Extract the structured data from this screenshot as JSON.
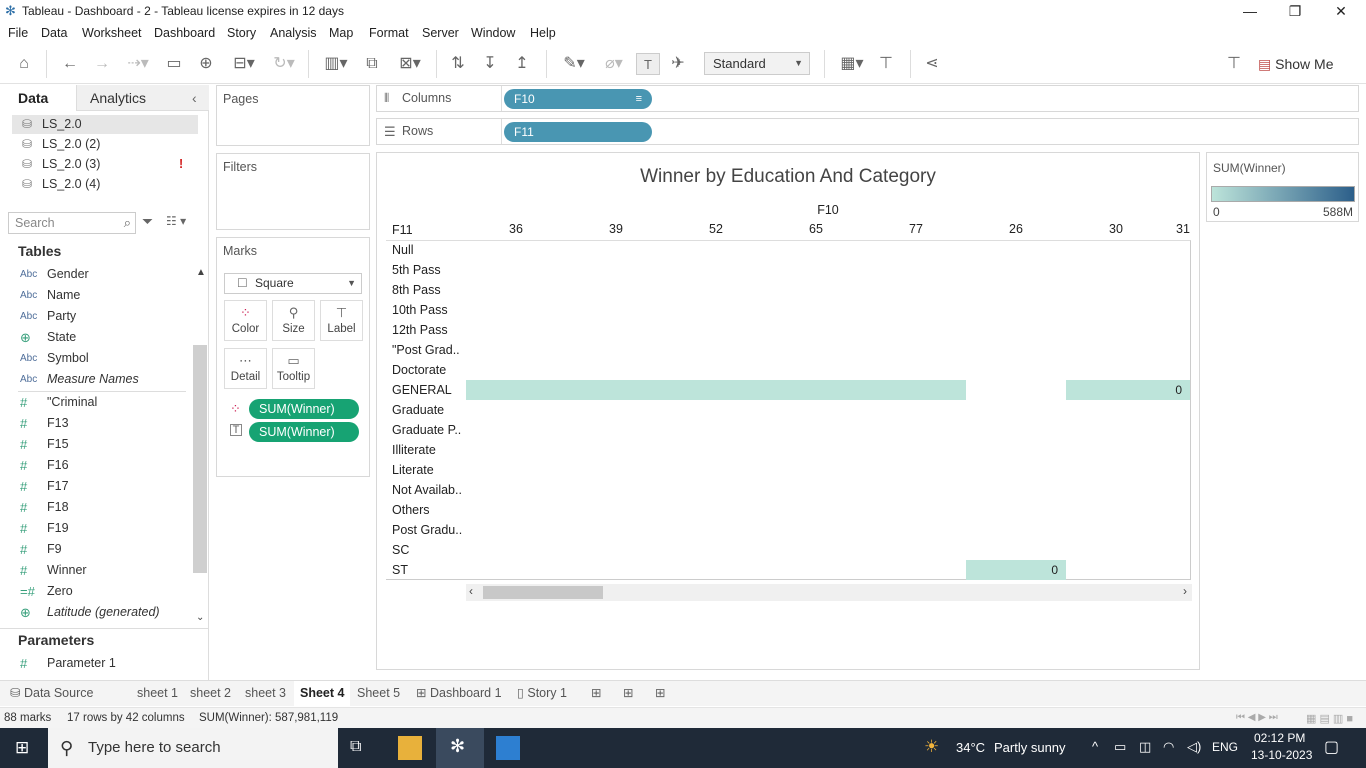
{
  "window": {
    "title": "Tableau - Dashboard - 2 - Tableau license expires in 12 days",
    "minimize": "—",
    "maximize": "❐",
    "close": "✕"
  },
  "menu": [
    "File",
    "Data",
    "Worksheet",
    "Dashboard",
    "Story",
    "Analysis",
    "Map",
    "Format",
    "Server",
    "Window",
    "Help"
  ],
  "toolbar": {
    "mark_size_dropdown": "Standard",
    "show_me": "Show Me"
  },
  "left_panel": {
    "tab_data": "Data",
    "tab_analytics": "Analytics",
    "datasources": [
      {
        "name": "LS_2.0",
        "selected": true
      },
      {
        "name": "LS_2.0 (2)"
      },
      {
        "name": "LS_2.0 (3)",
        "warning": "!"
      },
      {
        "name": "LS_2.0 (4)"
      }
    ],
    "search_placeholder": "Search",
    "tables_heading": "Tables",
    "fields": [
      {
        "type": "Abc",
        "name": "Gender"
      },
      {
        "type": "Abc",
        "name": "Name"
      },
      {
        "type": "Abc",
        "name": "Party"
      },
      {
        "type": "geo",
        "name": "State"
      },
      {
        "type": "Abc",
        "name": "Symbol"
      },
      {
        "type": "Abc",
        "name": "Measure Names",
        "italic": true
      },
      {
        "type": "num",
        "name": "\"Criminal"
      },
      {
        "type": "num",
        "name": "F13"
      },
      {
        "type": "num",
        "name": "F15"
      },
      {
        "type": "num",
        "name": "F16"
      },
      {
        "type": "num",
        "name": "F17"
      },
      {
        "type": "num",
        "name": "F18"
      },
      {
        "type": "num",
        "name": "F19"
      },
      {
        "type": "num",
        "name": "F9"
      },
      {
        "type": "num",
        "name": "Winner"
      },
      {
        "type": "num",
        "name": "Zero"
      },
      {
        "type": "geo",
        "name": "Latitude (generated)",
        "italic": true
      }
    ],
    "parameters_heading": "Parameters",
    "parameters": [
      {
        "type": "num",
        "name": "Parameter 1"
      }
    ]
  },
  "shelves": {
    "pages": "Pages",
    "filters": "Filters",
    "marks": "Marks",
    "mark_type": "Square",
    "mark_buttons": [
      "Color",
      "Size",
      "Label",
      "Detail",
      "Tooltip"
    ],
    "mark_pills": [
      {
        "icon": "color",
        "label": "SUM(Winner)"
      },
      {
        "icon": "label",
        "label": "SUM(Winner)"
      }
    ],
    "columns_label": "Columns",
    "columns_pill": "F10",
    "rows_label": "Rows",
    "rows_pill": "F11"
  },
  "viz": {
    "title": "Winner by Education And Category",
    "col_header": "F10",
    "row_header": "F11",
    "columns": [
      "36",
      "39",
      "52",
      "65",
      "77",
      "26",
      "30",
      "31"
    ],
    "rows": [
      "Null",
      "5th Pass",
      "8th Pass",
      "10th Pass",
      "12th Pass",
      "\"Post Grad..",
      "Doctorate",
      "GENERAL",
      "Graduate",
      "Graduate P..",
      "Illiterate",
      "Literate",
      "Not Availab..",
      "Others",
      "Post Gradu..",
      "SC",
      "ST"
    ],
    "filled_cells": [
      {
        "row": "GENERAL",
        "from_col": 0,
        "to_col": 4
      },
      {
        "row": "GENERAL",
        "from_col": 6,
        "to_col": 7,
        "label": "0"
      },
      {
        "row": "ST",
        "from_col": 5,
        "to_col": 5,
        "label": "0"
      }
    ]
  },
  "legend": {
    "title": "SUM(Winner)",
    "min": "0",
    "max": "588M",
    "color_start": "#bde4da",
    "color_end": "#2c5f8a"
  },
  "sheet_tabs": [
    {
      "label": "Data Source"
    },
    {
      "label": "sheet 1"
    },
    {
      "label": "sheet 2"
    },
    {
      "label": "sheet 3"
    },
    {
      "label": "Sheet 4",
      "active": true
    },
    {
      "label": "Sheet 5"
    },
    {
      "label": "Dashboard 1"
    },
    {
      "label": "Story 1"
    }
  ],
  "status": {
    "marks": "88 marks",
    "dims": "17 rows by 42 columns",
    "sum": "SUM(Winner): 587,981,119"
  },
  "taskbar": {
    "search_placeholder": "Type here to search",
    "weather_temp": "34°C",
    "weather_text": "Partly sunny",
    "lang": "ENG",
    "time": "02:12 PM",
    "date": "13-10-2023"
  },
  "colors": {
    "pill_blue": "#4996b2",
    "pill_green": "#17a373",
    "cell_fill": "#bde4da"
  }
}
